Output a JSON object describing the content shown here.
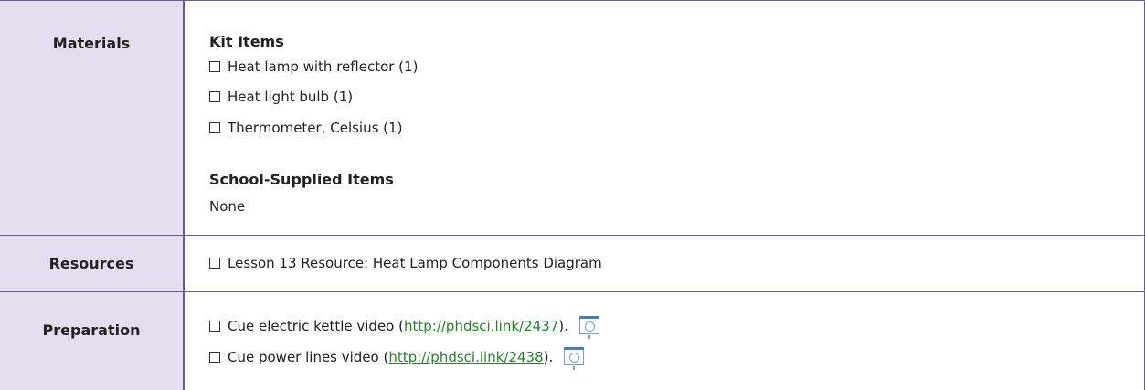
{
  "materials": {
    "label": "Materials",
    "kit_heading": "Kit Items",
    "kit_items": [
      "Heat lamp with reflector (1)",
      "Heat light bulb (1)",
      "Thermometer, Celsius (1)"
    ],
    "school_heading": "School-Supplied Items",
    "school_items": "None"
  },
  "resources": {
    "label": "Resources",
    "items": [
      "Lesson 13 Resource: Heat Lamp Components Diagram"
    ]
  },
  "preparation": {
    "label": "Preparation",
    "items": [
      {
        "prefix": "Cue electric kettle video (",
        "link": "http://phdsci.link/2437",
        "suffix": ")."
      },
      {
        "prefix": "Cue power lines video (",
        "link": "http://phdsci.link/2438",
        "suffix": ")."
      }
    ]
  },
  "icons": {
    "checkbox": "checkbox-icon",
    "video": "video-icon"
  }
}
